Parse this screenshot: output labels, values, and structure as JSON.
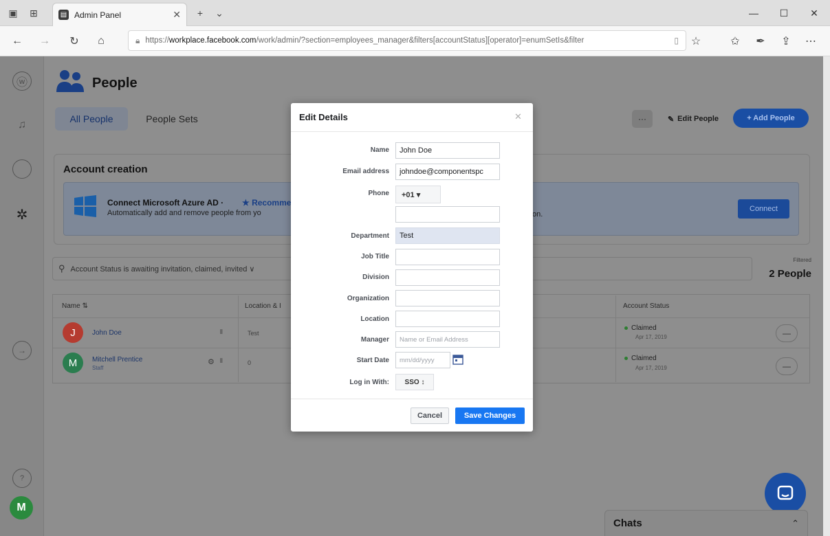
{
  "browser": {
    "tab_title": "Admin Panel",
    "url_prefix": "https://",
    "url_host": "workplace.facebook.com",
    "url_rest": "/work/admin/?section=employees_manager&filters[accountStatus][operator]=enumSetIs&filter"
  },
  "page": {
    "title": "People",
    "tabs": [
      "All People",
      "People Sets"
    ],
    "more_label": "···",
    "edit_people": "Edit People",
    "add_people": "+ Add People"
  },
  "account_creation": {
    "title": "Account creation",
    "azure_title": "Connect Microsoft Azure AD ·",
    "azure_recommended": "★ Recomme",
    "azure_desc": "Automatically add and remove people from yo",
    "azure_desc_tail": "on.",
    "connect": "Connect"
  },
  "search": {
    "query": "Account Status is awaiting invitation, claimed, invited ∨",
    "filtered_label": "Filtered",
    "count": "2 People"
  },
  "table": {
    "headers": [
      "Name ⇅",
      "Location & I",
      "Account Status"
    ],
    "rows": [
      {
        "initial": "J",
        "name": "John Doe",
        "sub": "",
        "location": "Test",
        "status": "Claimed",
        "status_date": "Apr 17, 2019",
        "color": "#c0392b"
      },
      {
        "initial": "M",
        "name": "Mitchell Prentice",
        "sub": "Staff",
        "location": "0",
        "status": "Claimed",
        "status_date": "Apr 17, 2019",
        "color": "#2e8b57"
      }
    ]
  },
  "chats": {
    "label": "Chats"
  },
  "me": {
    "initial": "M"
  },
  "modal": {
    "title": "Edit Details",
    "close": "✕",
    "labels": {
      "name": "Name",
      "email": "Email address",
      "phone": "Phone",
      "department": "Department",
      "job_title": "Job Title",
      "division": "Division",
      "organization": "Organization",
      "location": "Location",
      "manager": "Manager",
      "start_date": "Start Date",
      "login": "Log in With:"
    },
    "values": {
      "name": "John Doe",
      "email": "johndoe@componentspc",
      "phone_code": "+01 ▾",
      "phone": "",
      "department": "Test",
      "job_title": "",
      "division": "",
      "organization": "",
      "location": "",
      "login": "SSO ↕"
    },
    "placeholders": {
      "manager": "Name or Email Address",
      "start_date": "mm/dd/yyyy"
    },
    "cancel": "Cancel",
    "save": "Save Changes"
  },
  "colors": {
    "accent": "#1877f2",
    "overlay_dim": "#8e8e8e"
  }
}
